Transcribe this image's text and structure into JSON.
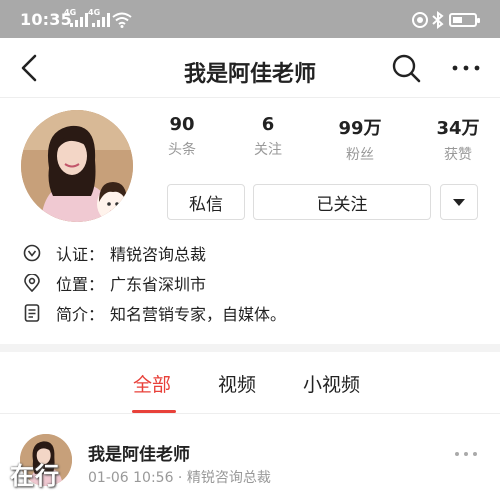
{
  "status_bar": {
    "time": "10:35",
    "sim1_label": "4G",
    "sim2_label": "4G",
    "icons": [
      "signal-icon",
      "signal-icon",
      "wifi-icon",
      "alarm-icon",
      "bluetooth-icon",
      "battery-icon"
    ],
    "battery_level": 0.45
  },
  "header": {
    "title": "我是阿佳老师",
    "icons": [
      "back-arrow-icon",
      "search-icon",
      "more-dots-icon"
    ]
  },
  "profile": {
    "stats": [
      {
        "value": "90",
        "label": "头条"
      },
      {
        "value": "6",
        "label": "关注"
      },
      {
        "value": "99万",
        "label": "粉丝"
      },
      {
        "value": "34万",
        "label": "获赞"
      }
    ],
    "message_button": "私信",
    "follow_button": "已关注",
    "info": [
      {
        "icon": "verified-icon",
        "label": "认证：",
        "value": "精锐咨询总裁"
      },
      {
        "icon": "location-icon",
        "label": "位置：",
        "value": "广东省深圳市"
      },
      {
        "icon": "intro-icon",
        "label": "简介：",
        "value": "知名营销专家，自媒体。"
      }
    ]
  },
  "tabs": {
    "items": [
      "全部",
      "视频",
      "小视频"
    ],
    "active": "全部"
  },
  "feed": {
    "first_item": {
      "author": "我是阿佳老师",
      "meta": "01-06 10:56 · 精锐咨询总裁"
    }
  },
  "watermark": "在行",
  "colors": {
    "accent": "#e8413a",
    "status_bar": "#a9a9a9",
    "muted_text": "#999999"
  }
}
